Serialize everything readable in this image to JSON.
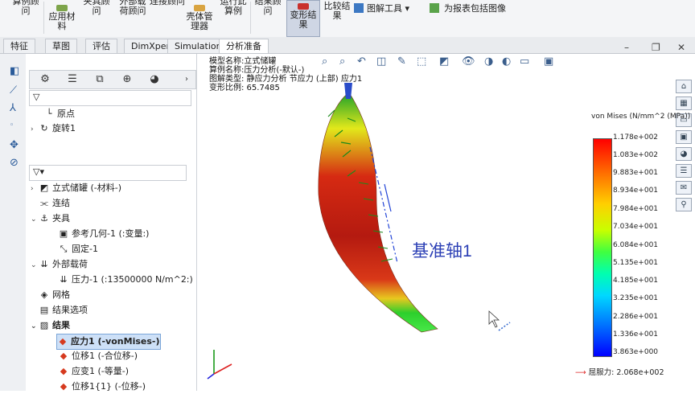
{
  "ribbon": {
    "btn_case_advisor": "算例顾问",
    "btn_apply_material": "应用材料",
    "btn_fixtures_advisor": "夹具顾问",
    "btn_external_loads_advisor": "外部载荷顾问",
    "btn_connections_advisor": "连接顾问",
    "btn_shell_manager": "壳体管理器",
    "btn_run_study": "运行此算例",
    "btn_results_advisor": "结果顾问",
    "btn_deformed_result": "变形结果",
    "btn_compare_results": "比较结果",
    "btn_plot_tools": "图解工具",
    "btn_include_image": "为报表包括图像"
  },
  "tabs": [
    "特征",
    "草图",
    "评估",
    "DimXpert",
    "Simulation",
    "分析准备"
  ],
  "tree_top": [
    {
      "label": "原点",
      "icon": "origin-icon"
    },
    {
      "label": "旋转1",
      "icon": "revolve-icon"
    }
  ],
  "tree": [
    {
      "label": "立式储罐 (-材料-)",
      "icon": "part-icon"
    },
    {
      "label": "连结",
      "icon": "connection-icon"
    },
    {
      "label": "夹具",
      "icon": "fixture-icon"
    },
    {
      "label": "参考几何-1 (:变量:)",
      "icon": "ref-geometry-icon"
    },
    {
      "label": "固定-1",
      "icon": "fixed-icon"
    },
    {
      "label": "外部载荷",
      "icon": "load-icon"
    },
    {
      "label": "压力-1 (:13500000 N/m^2:)",
      "icon": "pressure-icon"
    },
    {
      "label": "网格",
      "icon": "mesh-icon"
    },
    {
      "label": "结果选项",
      "icon": "result-options-icon"
    },
    {
      "label": "结果",
      "icon": "results-folder-icon"
    },
    {
      "label": "应力1 (-vonMises-)",
      "icon": "stress-plot-icon"
    },
    {
      "label": "位移1 (-合位移-)",
      "icon": "displacement-plot-icon"
    },
    {
      "label": "应变1 (-等量-)",
      "icon": "strain-plot-icon"
    },
    {
      "label": "位移1{1} (-位移-)",
      "icon": "displacement-plot-icon"
    }
  ],
  "info": {
    "model_name": "模型名称:立式储罐",
    "study_name": "算例名称:压力分析(-默认-)",
    "plot_type": "图解类型: 静应力分析 节应力 (上部) 应力1",
    "deform_scale": "变形比例: 65.7485"
  },
  "axis_label": "基准轴1",
  "legend": {
    "title": "von Mises (N/mm^2 (MPa))",
    "ticks": [
      "1.178e+002",
      "1.083e+002",
      "9.883e+001",
      "8.934e+001",
      "7.984e+001",
      "7.034e+001",
      "6.084e+001",
      "5.135e+001",
      "4.185e+001",
      "3.235e+001",
      "2.286e+001",
      "1.336e+001",
      "3.863e+000"
    ],
    "yield_label": "屈服力: 2.068e+002",
    "colors": {
      "max": "#ff0000",
      "mid": "#40ff40",
      "min": "#0000ff"
    }
  }
}
